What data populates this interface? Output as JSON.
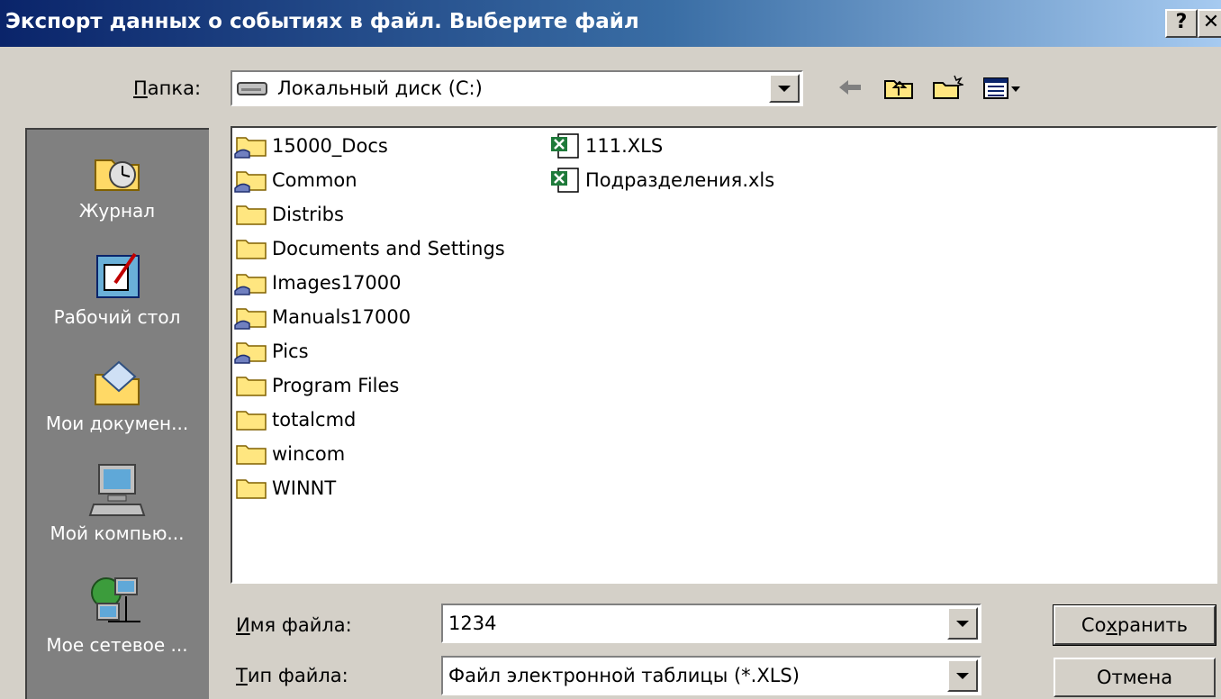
{
  "window": {
    "title": "Экспорт данных о событиях в файл. Выберите файл",
    "help_label": "?",
    "close_label": "✕"
  },
  "toolbar": {
    "folder_label_u": "П",
    "folder_label_rest": "апка:",
    "folder_value": "Локальный диск (C:)",
    "icons": [
      "back-arrow-icon",
      "up-folder-icon",
      "new-folder-icon",
      "view-menu-icon"
    ]
  },
  "places": [
    {
      "label": "Журнал",
      "icon": "history-icon"
    },
    {
      "label": "Рабочий стол",
      "icon": "desktop-icon"
    },
    {
      "label": "Мои докумен...",
      "icon": "my-documents-icon"
    },
    {
      "label": "Мой компью...",
      "icon": "my-computer-icon"
    },
    {
      "label": "Мое сетевое ...",
      "icon": "network-places-icon"
    }
  ],
  "files": [
    {
      "name": "15000_Docs",
      "type": "shared-folder"
    },
    {
      "name": "Common",
      "type": "shared-folder"
    },
    {
      "name": "Distribs",
      "type": "folder"
    },
    {
      "name": "Documents and Settings",
      "type": "folder"
    },
    {
      "name": "Images17000",
      "type": "shared-folder"
    },
    {
      "name": "Manuals17000",
      "type": "shared-folder"
    },
    {
      "name": "Pics",
      "type": "shared-folder"
    },
    {
      "name": "Program Files",
      "type": "folder"
    },
    {
      "name": "totalcmd",
      "type": "folder"
    },
    {
      "name": "wincom",
      "type": "folder"
    },
    {
      "name": "WINNT",
      "type": "folder"
    },
    {
      "name": "111.XLS",
      "type": "excel"
    },
    {
      "name": "Подразделения.xls",
      "type": "excel"
    }
  ],
  "form": {
    "filename_label_u": "И",
    "filename_label_rest": "мя файла:",
    "filename_value": "1234",
    "filetype_label_u": "Т",
    "filetype_label_rest": "ип файла:",
    "filetype_value": "Файл электронной таблицы (*.XLS)"
  },
  "buttons": {
    "save_pre": "Со",
    "save_u": "х",
    "save_post": "ранить",
    "cancel": "Отмена"
  }
}
